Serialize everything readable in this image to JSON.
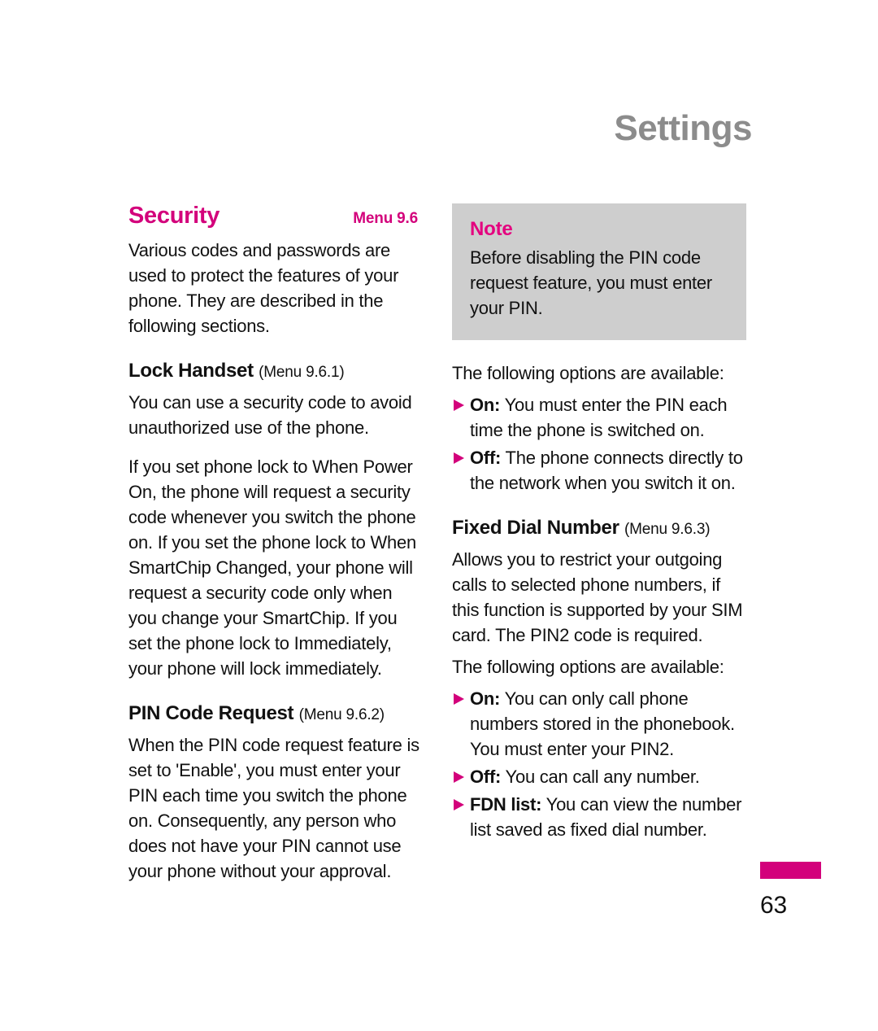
{
  "header": {
    "title": "Settings"
  },
  "theme": {
    "accent_pink": "#d3007b",
    "note_pink": "#e4007f",
    "header_gray": "#8c8c8c",
    "note_background": "#cecece"
  },
  "left_column": {
    "section": {
      "title": "Security",
      "menu": "Menu 9.6",
      "intro": "Various codes and passwords are used to protect the features of your phone. They are described in the following sections."
    },
    "subsections": [
      {
        "heading": "Lock Handset",
        "menu": "(Menu 9.6.1)",
        "paragraphs": [
          "You can use a security code to avoid unauthorized use of the phone.",
          "If you set phone lock to When Power On, the phone will request a security code whenever you switch the phone on. If you set the phone lock to When SmartChip Changed, your phone will request a security code only when you change your SmartChip. If you set the phone lock to Immediately, your phone will lock immediately."
        ]
      },
      {
        "heading": "PIN Code Request",
        "menu": "(Menu 9.6.2)",
        "paragraphs": [
          "When the PIN code request feature is set to 'Enable', you must enter your PIN each time you switch the phone on. Consequently, any person who does not have your PIN cannot use your phone without your approval."
        ]
      }
    ]
  },
  "right_column": {
    "note": {
      "title": "Note",
      "text": "Before disabling the PIN code request feature, you must enter your PIN."
    },
    "pin_options": {
      "intro": "The following options are available:",
      "items": [
        {
          "term": "On:",
          "text": " You must enter the PIN each time the phone is switched on."
        },
        {
          "term": "Off:",
          "text": " The phone connects directly to the network when you switch it on."
        }
      ]
    },
    "fixed_dial": {
      "heading": "Fixed Dial Number",
      "menu": "(Menu 9.6.3)",
      "paragraph": "Allows you to restrict your outgoing calls to selected phone numbers, if this function is supported by your SIM card. The PIN2 code is required.",
      "intro": "The following options are available:",
      "items": [
        {
          "term": "On:",
          "text": " You can only call phone numbers stored in the phonebook. You must enter your PIN2."
        },
        {
          "term": "Off:",
          "text": " You can call any number."
        },
        {
          "term": "FDN list:",
          "text": " You can view the number list saved as fixed dial number."
        }
      ]
    }
  },
  "footer": {
    "page_number": "63"
  }
}
